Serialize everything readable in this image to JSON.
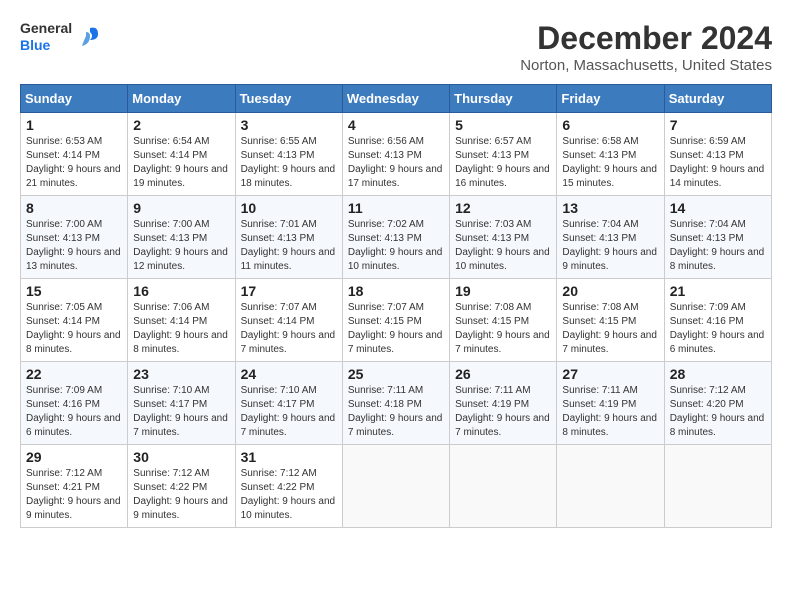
{
  "header": {
    "logo_line1": "General",
    "logo_line2": "Blue",
    "title": "December 2024",
    "subtitle": "Norton, Massachusetts, United States"
  },
  "weekdays": [
    "Sunday",
    "Monday",
    "Tuesday",
    "Wednesday",
    "Thursday",
    "Friday",
    "Saturday"
  ],
  "weeks": [
    [
      {
        "day": "1",
        "info": "Sunrise: 6:53 AM\nSunset: 4:14 PM\nDaylight: 9 hours and 21 minutes."
      },
      {
        "day": "2",
        "info": "Sunrise: 6:54 AM\nSunset: 4:14 PM\nDaylight: 9 hours and 19 minutes."
      },
      {
        "day": "3",
        "info": "Sunrise: 6:55 AM\nSunset: 4:13 PM\nDaylight: 9 hours and 18 minutes."
      },
      {
        "day": "4",
        "info": "Sunrise: 6:56 AM\nSunset: 4:13 PM\nDaylight: 9 hours and 17 minutes."
      },
      {
        "day": "5",
        "info": "Sunrise: 6:57 AM\nSunset: 4:13 PM\nDaylight: 9 hours and 16 minutes."
      },
      {
        "day": "6",
        "info": "Sunrise: 6:58 AM\nSunset: 4:13 PM\nDaylight: 9 hours and 15 minutes."
      },
      {
        "day": "7",
        "info": "Sunrise: 6:59 AM\nSunset: 4:13 PM\nDaylight: 9 hours and 14 minutes."
      }
    ],
    [
      {
        "day": "8",
        "info": "Sunrise: 7:00 AM\nSunset: 4:13 PM\nDaylight: 9 hours and 13 minutes."
      },
      {
        "day": "9",
        "info": "Sunrise: 7:00 AM\nSunset: 4:13 PM\nDaylight: 9 hours and 12 minutes."
      },
      {
        "day": "10",
        "info": "Sunrise: 7:01 AM\nSunset: 4:13 PM\nDaylight: 9 hours and 11 minutes."
      },
      {
        "day": "11",
        "info": "Sunrise: 7:02 AM\nSunset: 4:13 PM\nDaylight: 9 hours and 10 minutes."
      },
      {
        "day": "12",
        "info": "Sunrise: 7:03 AM\nSunset: 4:13 PM\nDaylight: 9 hours and 10 minutes."
      },
      {
        "day": "13",
        "info": "Sunrise: 7:04 AM\nSunset: 4:13 PM\nDaylight: 9 hours and 9 minutes."
      },
      {
        "day": "14",
        "info": "Sunrise: 7:04 AM\nSunset: 4:13 PM\nDaylight: 9 hours and 8 minutes."
      }
    ],
    [
      {
        "day": "15",
        "info": "Sunrise: 7:05 AM\nSunset: 4:14 PM\nDaylight: 9 hours and 8 minutes."
      },
      {
        "day": "16",
        "info": "Sunrise: 7:06 AM\nSunset: 4:14 PM\nDaylight: 9 hours and 8 minutes."
      },
      {
        "day": "17",
        "info": "Sunrise: 7:07 AM\nSunset: 4:14 PM\nDaylight: 9 hours and 7 minutes."
      },
      {
        "day": "18",
        "info": "Sunrise: 7:07 AM\nSunset: 4:15 PM\nDaylight: 9 hours and 7 minutes."
      },
      {
        "day": "19",
        "info": "Sunrise: 7:08 AM\nSunset: 4:15 PM\nDaylight: 9 hours and 7 minutes."
      },
      {
        "day": "20",
        "info": "Sunrise: 7:08 AM\nSunset: 4:15 PM\nDaylight: 9 hours and 7 minutes."
      },
      {
        "day": "21",
        "info": "Sunrise: 7:09 AM\nSunset: 4:16 PM\nDaylight: 9 hours and 6 minutes."
      }
    ],
    [
      {
        "day": "22",
        "info": "Sunrise: 7:09 AM\nSunset: 4:16 PM\nDaylight: 9 hours and 6 minutes."
      },
      {
        "day": "23",
        "info": "Sunrise: 7:10 AM\nSunset: 4:17 PM\nDaylight: 9 hours and 7 minutes."
      },
      {
        "day": "24",
        "info": "Sunrise: 7:10 AM\nSunset: 4:17 PM\nDaylight: 9 hours and 7 minutes."
      },
      {
        "day": "25",
        "info": "Sunrise: 7:11 AM\nSunset: 4:18 PM\nDaylight: 9 hours and 7 minutes."
      },
      {
        "day": "26",
        "info": "Sunrise: 7:11 AM\nSunset: 4:19 PM\nDaylight: 9 hours and 7 minutes."
      },
      {
        "day": "27",
        "info": "Sunrise: 7:11 AM\nSunset: 4:19 PM\nDaylight: 9 hours and 8 minutes."
      },
      {
        "day": "28",
        "info": "Sunrise: 7:12 AM\nSunset: 4:20 PM\nDaylight: 9 hours and 8 minutes."
      }
    ],
    [
      {
        "day": "29",
        "info": "Sunrise: 7:12 AM\nSunset: 4:21 PM\nDaylight: 9 hours and 9 minutes."
      },
      {
        "day": "30",
        "info": "Sunrise: 7:12 AM\nSunset: 4:22 PM\nDaylight: 9 hours and 9 minutes."
      },
      {
        "day": "31",
        "info": "Sunrise: 7:12 AM\nSunset: 4:22 PM\nDaylight: 9 hours and 10 minutes."
      },
      null,
      null,
      null,
      null
    ]
  ]
}
